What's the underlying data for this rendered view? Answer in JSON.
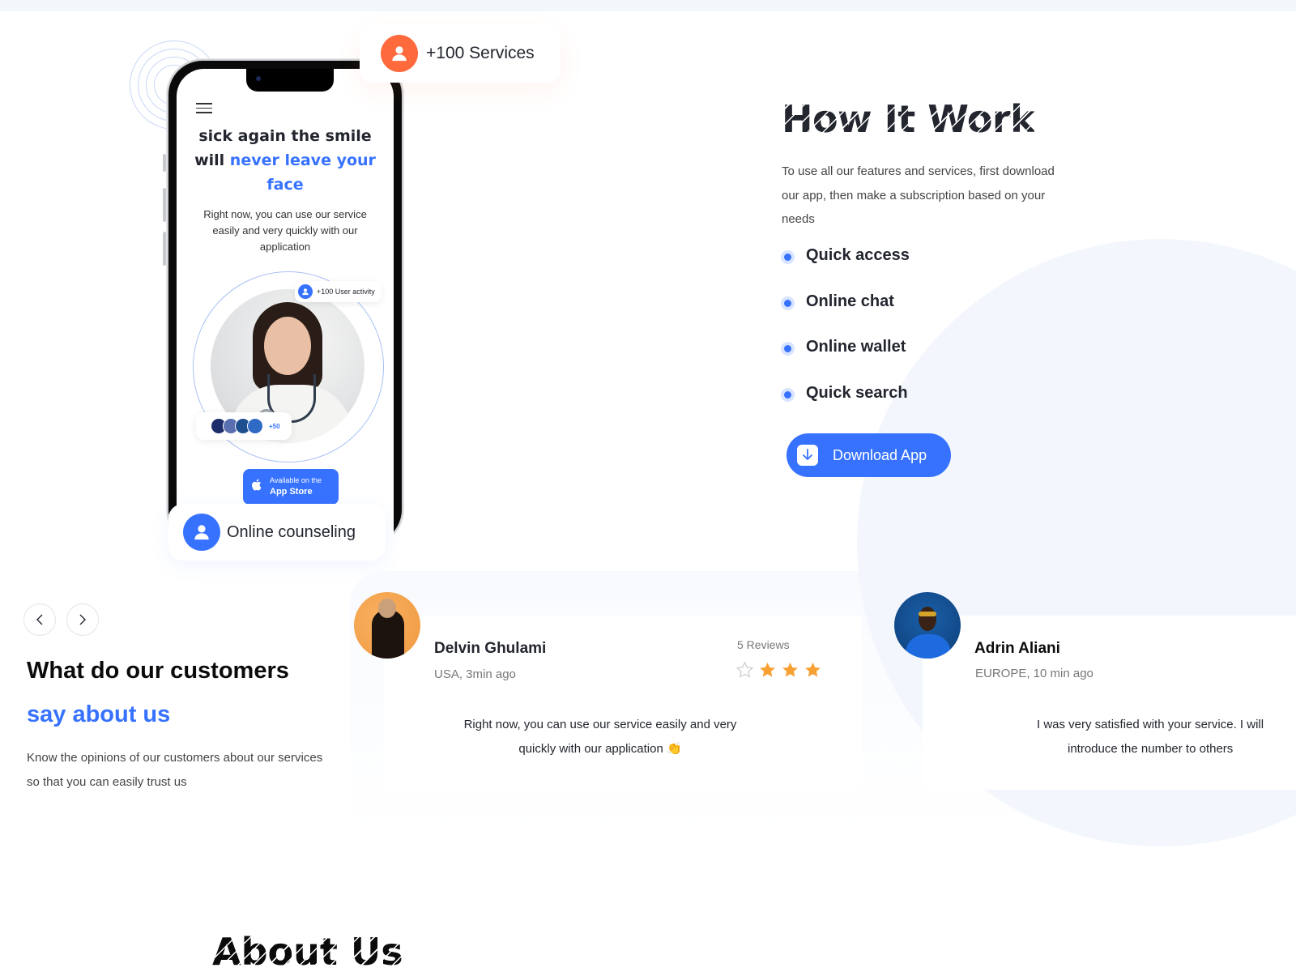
{
  "services_card": {
    "label": "+100 Services",
    "icon": "user-icon",
    "color": "#ff6a3d"
  },
  "phone": {
    "menu_icon": "hamburger-icon",
    "title_dark": "sick again the smile will ",
    "title_blue": "never leave your face",
    "description": "Right now, you can use our service easily and very quickly with our application",
    "activity_badge": "+100 User activity",
    "avatars_more": "+50",
    "appstore": {
      "small": "Available on the",
      "big": "App Store",
      "icon": "apple-icon"
    }
  },
  "counseling_card": {
    "label": "Online counseling",
    "icon": "user-icon"
  },
  "how_it_work": {
    "title": "How It Work",
    "description": "To use all our features and services, first download our app, then make a subscription based on your needs",
    "features": [
      "Quick access",
      "Online chat",
      "Online wallet",
      "Quick search"
    ],
    "download_button": "Download App"
  },
  "testimonials": {
    "prev_icon": "chevron-left-icon",
    "next_icon": "chevron-right-icon",
    "title_line1": "What do our customers",
    "title_line2": "say about us",
    "description": "Know the opinions of our customers about our services so that you can easily trust us",
    "reviews": [
      {
        "name": "Delvin Ghulami",
        "meta": "USA, 3min ago",
        "reviews_count": "5 Reviews",
        "rating": 3,
        "rating_max": 4,
        "text": "Right now, you can use our service easily and very quickly with our application 👏"
      },
      {
        "name": "Adrin Aliani",
        "meta": "EUROPE, 10 min ago",
        "text": "I was very satisfied with your service. I will introduce the number to others"
      }
    ]
  },
  "about": {
    "title": "About Us"
  },
  "colors": {
    "primary": "#3772ff",
    "accent_orange": "#ff6a3d",
    "star": "#f7a034",
    "text_dark": "#23262f"
  }
}
